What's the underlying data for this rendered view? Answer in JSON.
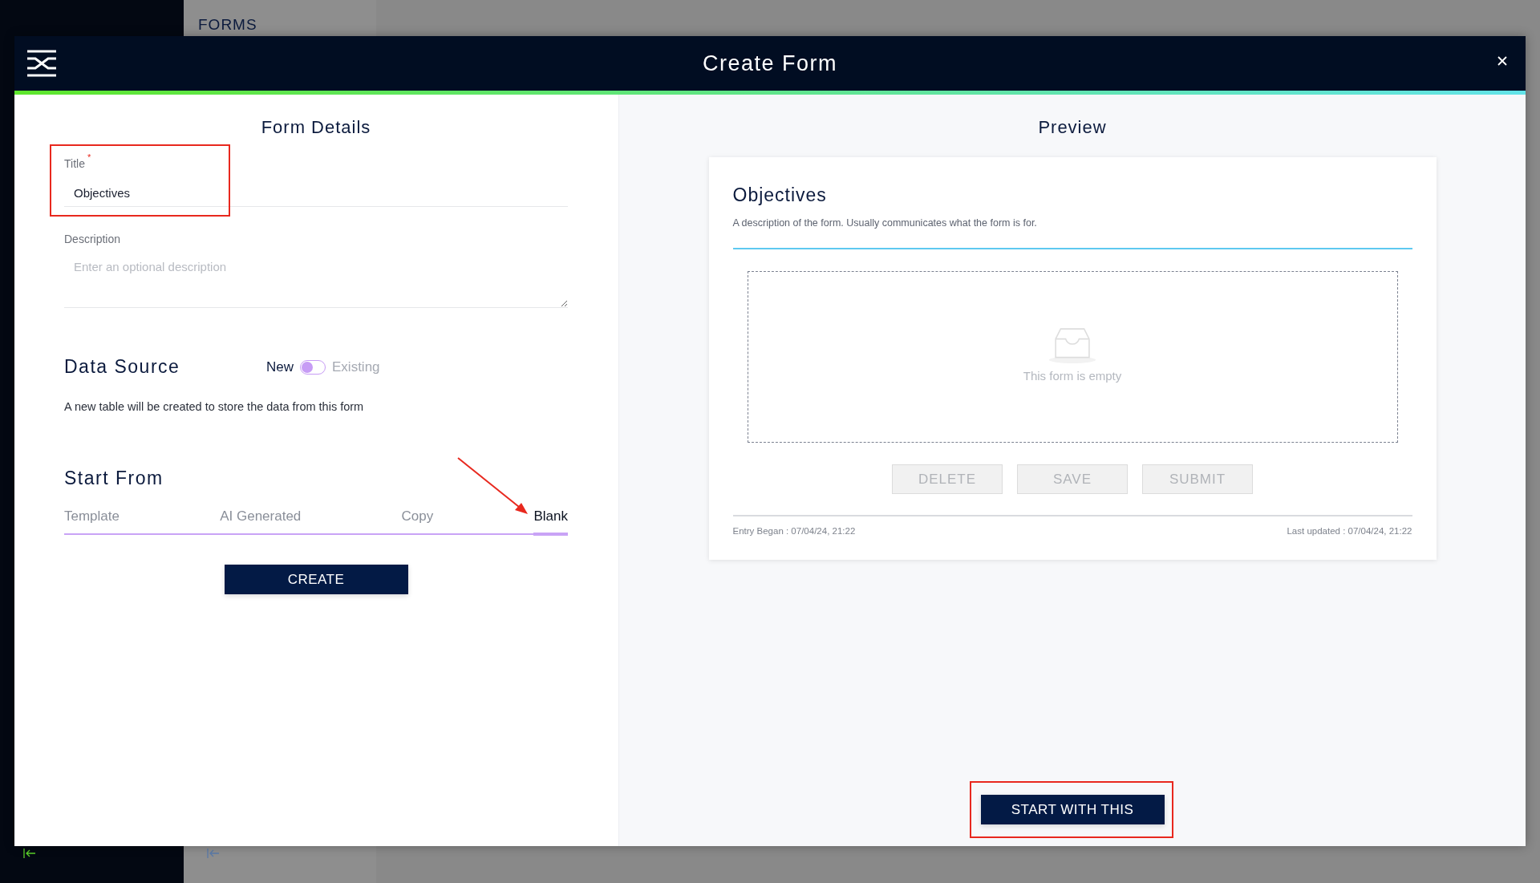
{
  "background": {
    "section_title": "FORMS"
  },
  "dialog": {
    "title": "Create Form"
  },
  "form_details": {
    "heading": "Form Details",
    "title_field": {
      "label": "Title",
      "required_mark": "*",
      "value": "Objectives"
    },
    "description_field": {
      "label": "Description",
      "placeholder": "Enter an optional description"
    }
  },
  "data_source": {
    "heading": "Data Source",
    "option_new": "New",
    "option_existing": "Existing",
    "existing": false,
    "note": "A new table will be created to store the data from this form"
  },
  "start_from": {
    "heading": "Start From",
    "tabs": [
      {
        "label": "Template",
        "selected": false
      },
      {
        "label": "AI Generated",
        "selected": false
      },
      {
        "label": "Copy",
        "selected": false
      },
      {
        "label": "Blank",
        "selected": true
      }
    ],
    "create_button": "CREATE"
  },
  "preview": {
    "heading": "Preview",
    "form_title": "Objectives",
    "form_description": "A description of the form. Usually communicates what the form is for.",
    "empty_text": "This form is empty",
    "buttons": [
      "DELETE",
      "SAVE",
      "SUBMIT"
    ],
    "entry_began": "Entry Began : 07/04/24, 21:22",
    "last_updated": "Last updated : 07/04/24, 21:22",
    "start_button": "START WITH THIS"
  }
}
